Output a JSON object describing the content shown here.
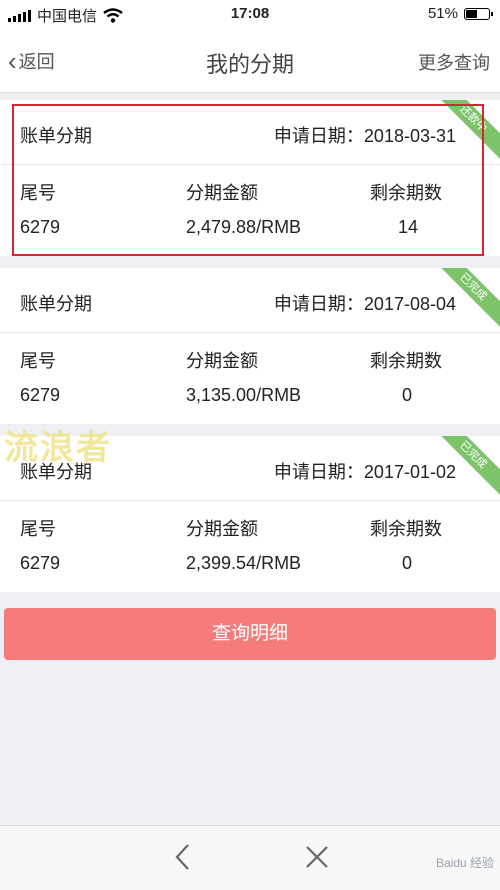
{
  "status_bar": {
    "carrier": "中国电信",
    "time": "17:08",
    "battery": "51%",
    "battery_level": 0.51
  },
  "nav": {
    "back_label": "返回",
    "title": "我的分期",
    "more_label": "更多查询"
  },
  "columns": {
    "tail": "尾号",
    "amount": "分期金额",
    "remaining": "剩余期数"
  },
  "date_label": "申请日期：",
  "bills": [
    {
      "type": "账单分期",
      "date": "2018-03-31",
      "tail": "6279",
      "amount": "2,479.88/RMB",
      "remaining": "14",
      "status": "还款中"
    },
    {
      "type": "账单分期",
      "date": "2017-08-04",
      "tail": "6279",
      "amount": "3,135.00/RMB",
      "remaining": "0",
      "status": "已完成"
    },
    {
      "type": "账单分期",
      "date": "2017-01-02",
      "tail": "6279",
      "amount": "2,399.54/RMB",
      "remaining": "0",
      "status": "已完成"
    }
  ],
  "watermark": "流浪者",
  "query_button": "查询明细",
  "bottom_watermark": "Baidu 经验"
}
